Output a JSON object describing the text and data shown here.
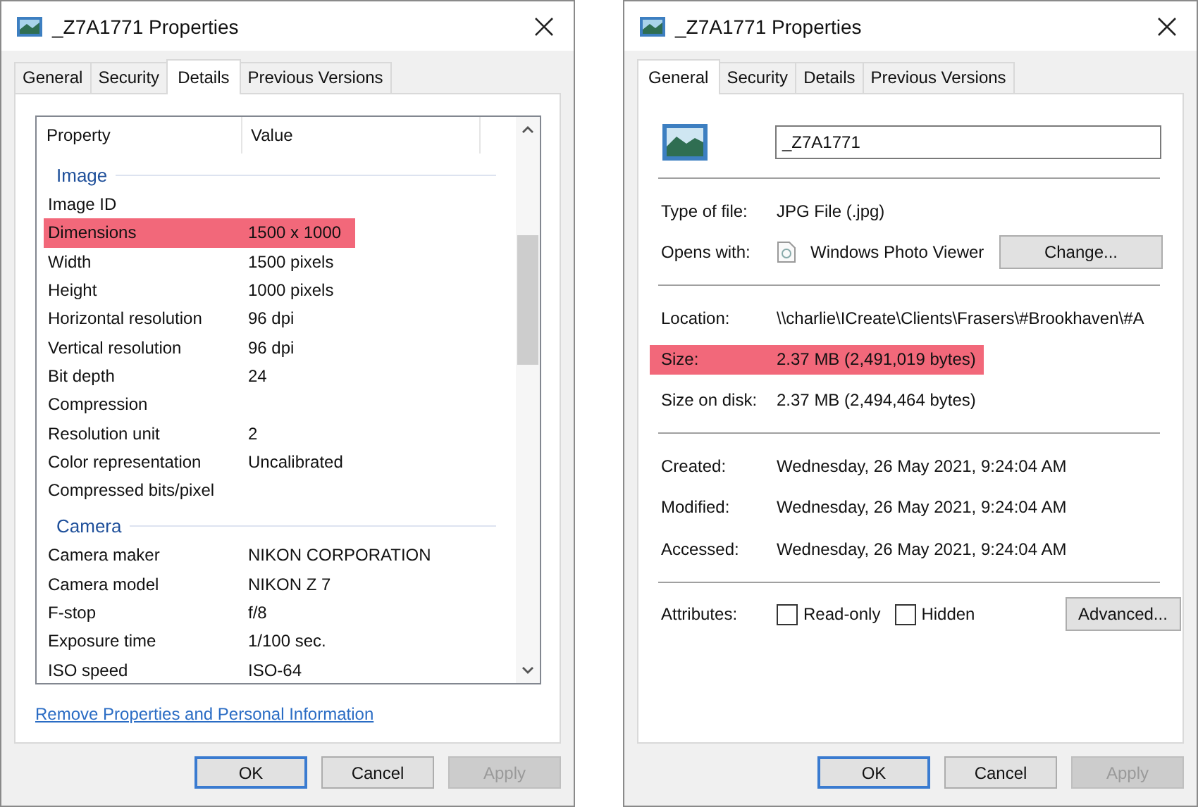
{
  "dialogs": [
    {
      "kind": "details",
      "title": "_Z7A1771 Properties",
      "tabs": [
        {
          "label": "General",
          "selected": false
        },
        {
          "label": "Security",
          "selected": false
        },
        {
          "label": "Details",
          "selected": true
        },
        {
          "label": "Previous Versions",
          "selected": false
        }
      ],
      "details": {
        "columns": [
          "Property",
          "Value"
        ],
        "groups": [
          {
            "name": "Image",
            "rows": [
              {
                "property": "Image ID",
                "highlighted": false
              },
              {
                "property": "Dimensions",
                "value": "1500 x 1000",
                "highlighted": true
              },
              {
                "property": "Width",
                "value": "1500 pixels",
                "highlighted": false
              },
              {
                "property": "Height",
                "value": "1000 pixels",
                "highlighted": false
              },
              {
                "property": "Horizontal resolution",
                "value": "96 dpi",
                "highlighted": false
              },
              {
                "property": "Vertical resolution",
                "value": "96 dpi",
                "highlighted": false
              },
              {
                "property": "Bit depth",
                "value": "24",
                "highlighted": false
              },
              {
                "property": "Compression",
                "highlighted": false
              },
              {
                "property": "Resolution unit",
                "value": "2",
                "highlighted": false
              },
              {
                "property": "Color representation",
                "value": "Uncalibrated",
                "highlighted": false
              },
              {
                "property": "Compressed bits/pixel",
                "highlighted": false
              }
            ]
          },
          {
            "name": "Camera",
            "rows": [
              {
                "property": "Camera maker",
                "value": "NIKON CORPORATION",
                "highlighted": false
              },
              {
                "property": "Camera model",
                "value": "NIKON Z 7",
                "highlighted": false
              },
              {
                "property": "F-stop",
                "value": "f/8",
                "highlighted": false
              },
              {
                "property": "Exposure time",
                "value": "1/100 sec.",
                "highlighted": false
              },
              {
                "property": "ISO speed",
                "value": "ISO-64",
                "highlighted": false
              }
            ]
          }
        ]
      },
      "link": "Remove Properties and Personal Information",
      "buttons": [
        {
          "label": "OK",
          "default": true,
          "disabled": false
        },
        {
          "label": "Cancel",
          "default": false,
          "disabled": false
        },
        {
          "label": "Apply",
          "default": false,
          "disabled": true
        }
      ]
    },
    {
      "kind": "general",
      "title": "_Z7A1771 Properties",
      "tabs": [
        {
          "label": "General",
          "selected": true
        },
        {
          "label": "Security",
          "selected": false
        },
        {
          "label": "Details",
          "selected": false
        },
        {
          "label": "Previous Versions",
          "selected": false
        }
      ],
      "general": {
        "file_name": "_Z7A1771",
        "sections": [
          [
            {
              "kind": "text",
              "label": "Type of file:",
              "value": "JPG File (.jpg)",
              "highlighted": false
            },
            {
              "kind": "app",
              "label": "Opens with:",
              "value": "Windows Photo Viewer",
              "button": "Change...",
              "highlighted": false
            }
          ],
          [
            {
              "kind": "text",
              "label": "Location:",
              "value": "\\\\charlie\\ICreate\\Clients\\Frasers\\#Brookhaven\\#A",
              "highlighted": false
            },
            {
              "kind": "text",
              "label": "Size:",
              "value": "2.37 MB (2,491,019 bytes)",
              "highlighted": true
            },
            {
              "kind": "text",
              "label": "Size on disk:",
              "value": "2.37 MB (2,494,464 bytes)",
              "highlighted": false
            }
          ],
          [
            {
              "kind": "text",
              "label": "Created:",
              "value": "Wednesday, 26 May 2021, 9:24:04 AM",
              "highlighted": false
            },
            {
              "kind": "text",
              "label": "Modified:",
              "value": "Wednesday, 26 May 2021, 9:24:04 AM",
              "highlighted": false
            },
            {
              "kind": "text",
              "label": "Accessed:",
              "value": "Wednesday, 26 May 2021, 9:24:04 AM",
              "highlighted": false
            }
          ],
          [
            {
              "kind": "attributes",
              "label": "Attributes:",
              "checkboxes": [
                {
                  "label": "Read-only",
                  "checked": false
                },
                {
                  "label": "Hidden",
                  "checked": false
                }
              ],
              "button": "Advanced...",
              "highlighted": false
            }
          ]
        ]
      },
      "buttons": [
        {
          "label": "OK",
          "default": true,
          "disabled": false
        },
        {
          "label": "Cancel",
          "default": false,
          "disabled": false
        },
        {
          "label": "Apply",
          "default": false,
          "disabled": true
        }
      ]
    }
  ]
}
